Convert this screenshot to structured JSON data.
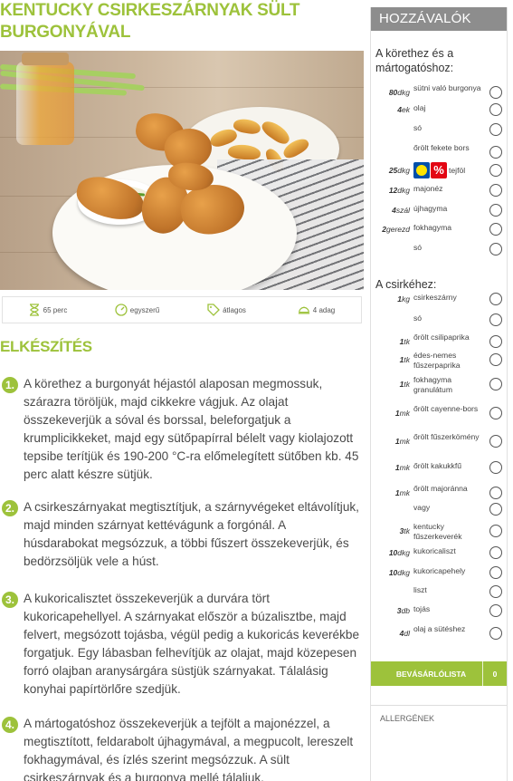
{
  "recipe": {
    "title_line1": "KENTUCKY CSIRKESZÁRNYAK SÜLT",
    "title_line2": "BURGONYÁVAL"
  },
  "meta": [
    {
      "icon": "hourglass-icon",
      "label": "65 perc"
    },
    {
      "icon": "speedometer-icon",
      "label": "egyszerű"
    },
    {
      "icon": "price-tag-icon",
      "label": "átlagos"
    },
    {
      "icon": "serving-dish-icon",
      "label": "4 adag"
    }
  ],
  "method": {
    "heading": "ELKÉSZÍTÉS",
    "steps": [
      {
        "num": "1.",
        "text": "A körethez a burgonyát héjastól alaposan megmossuk, szárazra töröljük, majd cikkekre vágjuk. Az olajat összekeverjük a sóval és borssal, beleforgatjuk a krumplicikkeket, majd egy sütőpapírral bélelt vagy kiolajozott tepsibe terítjük és 190-200 °C-ra előmelegített sütőben kb. 45 perc alatt készre sütjük."
      },
      {
        "num": "2.",
        "text": "A csirkeszárnyakat megtisztítjuk, a szárnyvégeket eltávolítjuk, majd minden szárnyat kettévágunk a forgónál. A húsdarabokat megsózzuk, a többi fűszert összekeverjük, és bedörzsöljük vele a húst."
      },
      {
        "num": "3.",
        "text": "A kukoricalisztet összekeverjük a durvára tört kukoricapehellyel. A szárnyakat először a búzalisztbe, majd felvert, megsózott tojásba, végül pedig a kukoricás keverékbe forgatjuk. Egy lábasban felhevítjük az olajat, majd közepesen forró olajban aranysárgára süstjük szárnyakat. Tálalásig konyhai papírtörlőre szedjük."
      },
      {
        "num": "4.",
        "text": "A mártogatóshoz összekeverjük a tejfölt a majonézzel, a megtisztított, feldarabolt újhagymával, a megpucolt, lereszelt fokhagymával, és ízlés szerint megsózzuk. A sült csirkeszárnyak és a burgonya mellé tálaljuk."
      }
    ]
  },
  "ingredients": {
    "heading": "HOZZÁVALÓK",
    "groups": [
      {
        "title": "A körethez és a mártogatóshoz:",
        "items": [
          {
            "amount": "80",
            "unit": "dkg",
            "name": "sütni való burgonya"
          },
          {
            "amount": "4",
            "unit": "ek",
            "name": "olaj"
          },
          {
            "amount": "",
            "unit": "",
            "name": "só"
          },
          {
            "amount": "",
            "unit": "",
            "name": "őrölt fekete bors"
          },
          {
            "amount": "25",
            "unit": "dkg",
            "name": "tejföl",
            "badges": [
              "lidl-logo-icon",
              "percent-badge-icon"
            ],
            "badge_text": "%"
          },
          {
            "amount": "12",
            "unit": "dkg",
            "name": "majonéz"
          },
          {
            "amount": "4",
            "unit": "szál",
            "name": "újhagyma"
          },
          {
            "amount": "2",
            "unit": "gerezd",
            "name": "fokhagyma"
          },
          {
            "amount": "",
            "unit": "",
            "name": "só"
          }
        ]
      },
      {
        "title": "A csirkéhez:",
        "items": [
          {
            "amount": "1",
            "unit": "kg",
            "name": "csirkeszárny"
          },
          {
            "amount": "",
            "unit": "",
            "name": "só"
          },
          {
            "amount": "1",
            "unit": "tk",
            "name": "őrölt csilipaprika"
          },
          {
            "amount": "1",
            "unit": "tk",
            "name": "édes-nemes fűszerpaprika"
          },
          {
            "amount": "1",
            "unit": "tk",
            "name": "fokhagyma granulátum"
          },
          {
            "amount": "1",
            "unit": "mk",
            "name": "őrölt cayenne-bors"
          },
          {
            "amount": "1",
            "unit": "mk",
            "name": "őrölt fűszerkömény"
          },
          {
            "amount": "1",
            "unit": "mk",
            "name": "őrölt kakukkfű"
          },
          {
            "amount": "1",
            "unit": "mk",
            "name": "őrölt majoránna"
          },
          {
            "amount": "",
            "unit": "",
            "name": "vagy"
          },
          {
            "amount": "3",
            "unit": "tk",
            "name": "kentucky fűszerkeverék"
          },
          {
            "amount": "10",
            "unit": "dkg",
            "name": "kukoricaliszt"
          },
          {
            "amount": "10",
            "unit": "dkg",
            "name": "kukoricapehely"
          },
          {
            "amount": "",
            "unit": "",
            "name": "liszt"
          },
          {
            "amount": "3",
            "unit": "db",
            "name": "tojás"
          },
          {
            "amount": "4",
            "unit": "dl",
            "name": "olaj a sütéshez"
          }
        ]
      }
    ],
    "shopping_label": "BEVÁSÁRLÓLISTA",
    "shopping_count": "0",
    "allergens_label": "ALLERGÉNEK"
  },
  "colors": {
    "accent": "#9dc23b",
    "panel_header": "#8d8d8d"
  }
}
